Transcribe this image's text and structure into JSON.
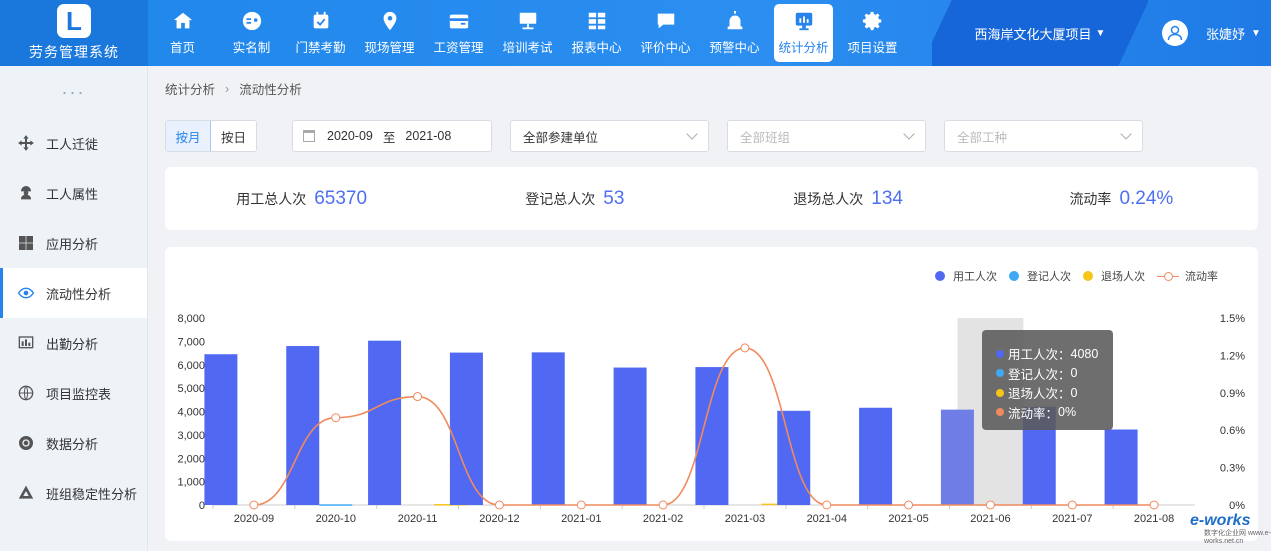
{
  "app": {
    "name": "劳务管理系统",
    "logo_letter": "L"
  },
  "nav": [
    {
      "label": "首页",
      "icon": "home-icon"
    },
    {
      "label": "实名制",
      "icon": "id-card-icon"
    },
    {
      "label": "门禁考勤",
      "icon": "calendar-check-icon"
    },
    {
      "label": "现场管理",
      "icon": "location-pin-icon"
    },
    {
      "label": "工资管理",
      "icon": "wallet-icon"
    },
    {
      "label": "培训考试",
      "icon": "presentation-board-icon"
    },
    {
      "label": "报表中心",
      "icon": "table-grid-icon"
    },
    {
      "label": "评价中心",
      "icon": "chat-bubble-icon"
    },
    {
      "label": "预警中心",
      "icon": "alarm-icon"
    },
    {
      "label": "统计分析",
      "icon": "stats-screen-icon",
      "active": true
    },
    {
      "label": "项目设置",
      "icon": "gear-icon"
    }
  ],
  "project": {
    "name": "西海岸文化大厦项目"
  },
  "user": {
    "name": "张婕妤"
  },
  "sidebar": {
    "items": [
      {
        "label": "工人迁徙",
        "icon": "move-arrows-icon"
      },
      {
        "label": "工人属性",
        "icon": "worker-icon"
      },
      {
        "label": "应用分析",
        "icon": "app-grid-icon"
      },
      {
        "label": "流动性分析",
        "icon": "flow-eye-icon",
        "active": true
      },
      {
        "label": "出勤分析",
        "icon": "bar-chart-icon"
      },
      {
        "label": "项目监控表",
        "icon": "globe-icon"
      },
      {
        "label": "数据分析",
        "icon": "target-icon"
      },
      {
        "label": "班组稳定性分析",
        "icon": "triangle-layers-icon"
      }
    ]
  },
  "breadcrumb": [
    "统计分析",
    "流动性分析"
  ],
  "filters": {
    "by_month": "按月",
    "by_day": "按日",
    "date_start": "2020-09",
    "date_sep": "至",
    "date_end": "2021-08",
    "unit_select": "全部参建单位",
    "team_placeholder": "全部班组",
    "trade_placeholder": "全部工种"
  },
  "stats": [
    {
      "label": "用工总人次",
      "value": "65370"
    },
    {
      "label": "登记总人次",
      "value": "53"
    },
    {
      "label": "退场总人次",
      "value": "134"
    },
    {
      "label": "流动率",
      "value": "0.24%"
    }
  ],
  "colors": {
    "primary": "#2683ec",
    "bar_work": "#5068f2",
    "bar_register": "#3fa9f5",
    "bar_exit": "#f5c518",
    "line_rate": "#f08a5d"
  },
  "chart_data": {
    "type": "bar",
    "categories": [
      "2020-09",
      "2020-10",
      "2020-11",
      "2020-12",
      "2021-01",
      "2021-02",
      "2021-03",
      "2021-04",
      "2021-05",
      "2021-06",
      "2021-07",
      "2021-08"
    ],
    "series": [
      {
        "name": "用工人次",
        "type": "bar",
        "axis": "left",
        "values": [
          6450,
          6800,
          7030,
          6520,
          6530,
          5880,
          5900,
          4030,
          4160,
          4080,
          4200,
          3230
        ]
      },
      {
        "name": "登记人次",
        "type": "bar",
        "axis": "left",
        "values": [
          0,
          30,
          0,
          0,
          0,
          0,
          0,
          0,
          0,
          0,
          0,
          0
        ]
      },
      {
        "name": "退场人次",
        "type": "bar",
        "axis": "left",
        "values": [
          0,
          0,
          40,
          0,
          0,
          0,
          60,
          0,
          0,
          0,
          0,
          0
        ]
      },
      {
        "name": "流动率",
        "type": "line",
        "axis": "right",
        "values": [
          0,
          0.7,
          0.87,
          0,
          0,
          0,
          1.26,
          0,
          0,
          0,
          0,
          0
        ]
      }
    ],
    "y_left": {
      "ticks": [
        "0",
        "1,000",
        "2,000",
        "3,000",
        "4,000",
        "5,000",
        "6,000",
        "7,000",
        "8,000"
      ],
      "range": [
        0,
        8000
      ]
    },
    "y_right": {
      "ticks": [
        "0%",
        "0.3%",
        "0.6%",
        "0.9%",
        "1.2%",
        "1.5%"
      ],
      "range": [
        0,
        1.5
      ]
    },
    "legend_position": "top-right",
    "highlight_index": 9,
    "tooltip": [
      {
        "label": "用工人次：",
        "value": "4080"
      },
      {
        "label": "登记人次：",
        "value": "0"
      },
      {
        "label": "退场人次：",
        "value": "0"
      },
      {
        "label": "流动率：",
        "value": "0%"
      }
    ]
  },
  "watermark": {
    "brand": "e-works",
    "caption": "数字化企业网 www.e-works.net.cn"
  }
}
